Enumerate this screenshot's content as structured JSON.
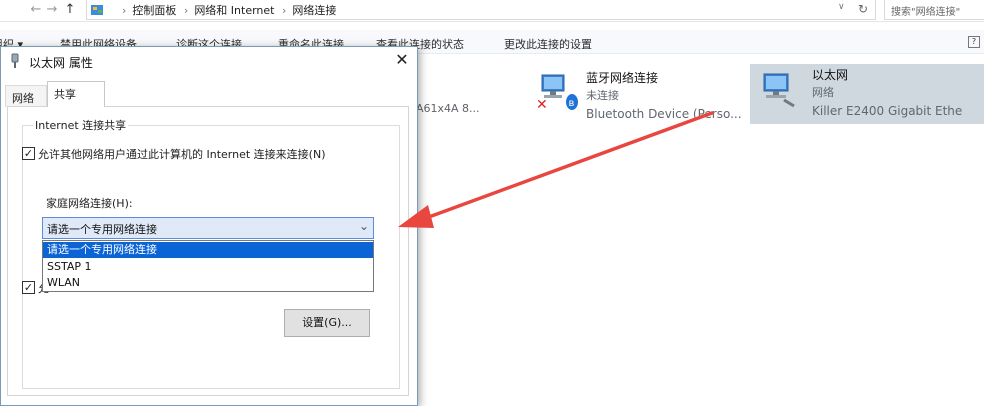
{
  "explorer": {
    "breadcrumb": [
      "控制面板",
      "网络和 Internet",
      "网络连接"
    ],
    "search_placeholder": "搜索\"网络连接\"",
    "toolbar": [
      "组织 ▾",
      "禁用此网络设备",
      "诊断这个连接",
      "重命名此连接",
      "查看此连接的状态",
      "更改此连接的设置"
    ],
    "partial_item_text": "A61x4A 8...",
    "connections": [
      {
        "name": "蓝牙网络连接",
        "status": "未连接",
        "device": "Bluetooth Device (Perso..."
      },
      {
        "name": "以太网",
        "status": "网络",
        "device": "Killer E2400 Gigabit Ethe"
      }
    ]
  },
  "dialog": {
    "title": "以太网 属性",
    "close_symbol": "✕",
    "tabs": [
      "网络",
      "共享"
    ],
    "group_label": "Internet 连接共享",
    "allow_checkbox_label": "允许其他网络用户通过此计算机的 Internet 连接来连接(N)",
    "allow_checked_mark": "✓",
    "second_checkbox_fragment": "允",
    "home_network_label": "家庭网络连接(H):",
    "combo_value": "请选一个专用网络连接",
    "combo_arrow": "⌄",
    "dropdown_options": [
      "请选一个专用网络连接",
      "SSTAP 1",
      "WLAN"
    ],
    "settings_button": "设置(G)..."
  },
  "colors": {
    "selection": "#0a64d6",
    "arrow": "#e8463e",
    "highlight_item": "#cfd7df"
  }
}
